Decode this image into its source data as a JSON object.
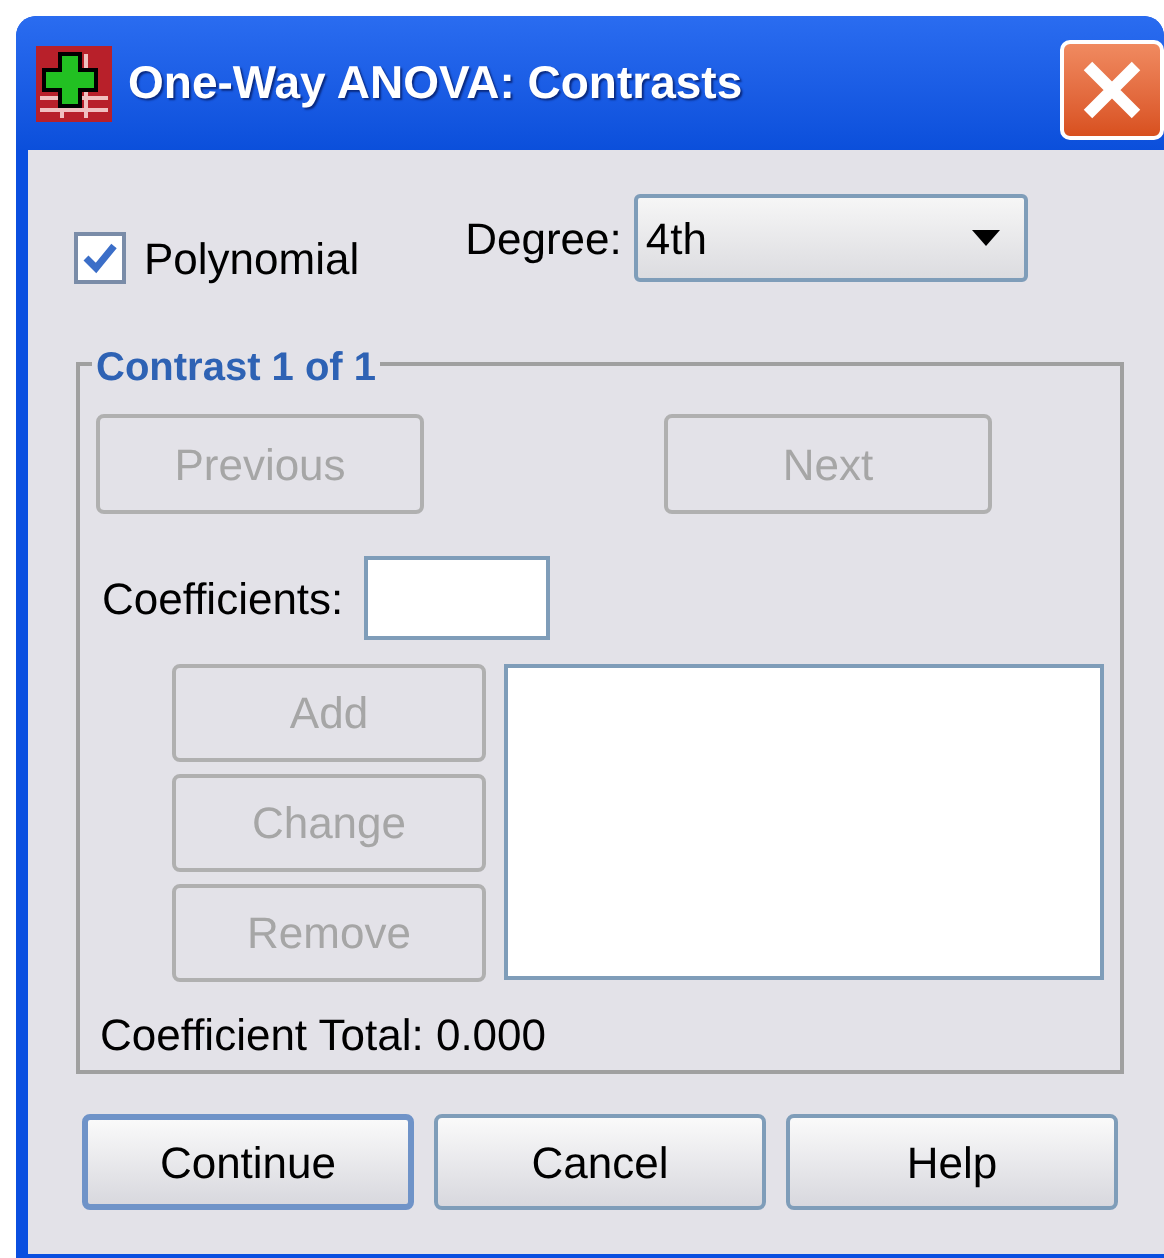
{
  "window": {
    "title": "One-Way ANOVA: Contrasts"
  },
  "polynomial": {
    "label": "Polynomial",
    "checked": true
  },
  "degree": {
    "label": "Degree:",
    "value": "4th"
  },
  "contrast_group": {
    "title": "Contrast 1 of 1",
    "nav_buttons": [
      {
        "label": "Previous",
        "disabled": true
      },
      {
        "label": "Next",
        "disabled": true
      }
    ],
    "coefficients": {
      "label": "Coefficients:"
    },
    "list_buttons": [
      {
        "label": "Add",
        "disabled": true
      },
      {
        "label": "Change",
        "disabled": true
      },
      {
        "label": "Remove",
        "disabled": true
      }
    ],
    "total": "Coefficient Total: 0.000"
  },
  "buttons": [
    {
      "label": "Continue",
      "default": true
    },
    {
      "label": "Cancel",
      "default": false
    },
    {
      "label": "Help",
      "default": false
    }
  ]
}
